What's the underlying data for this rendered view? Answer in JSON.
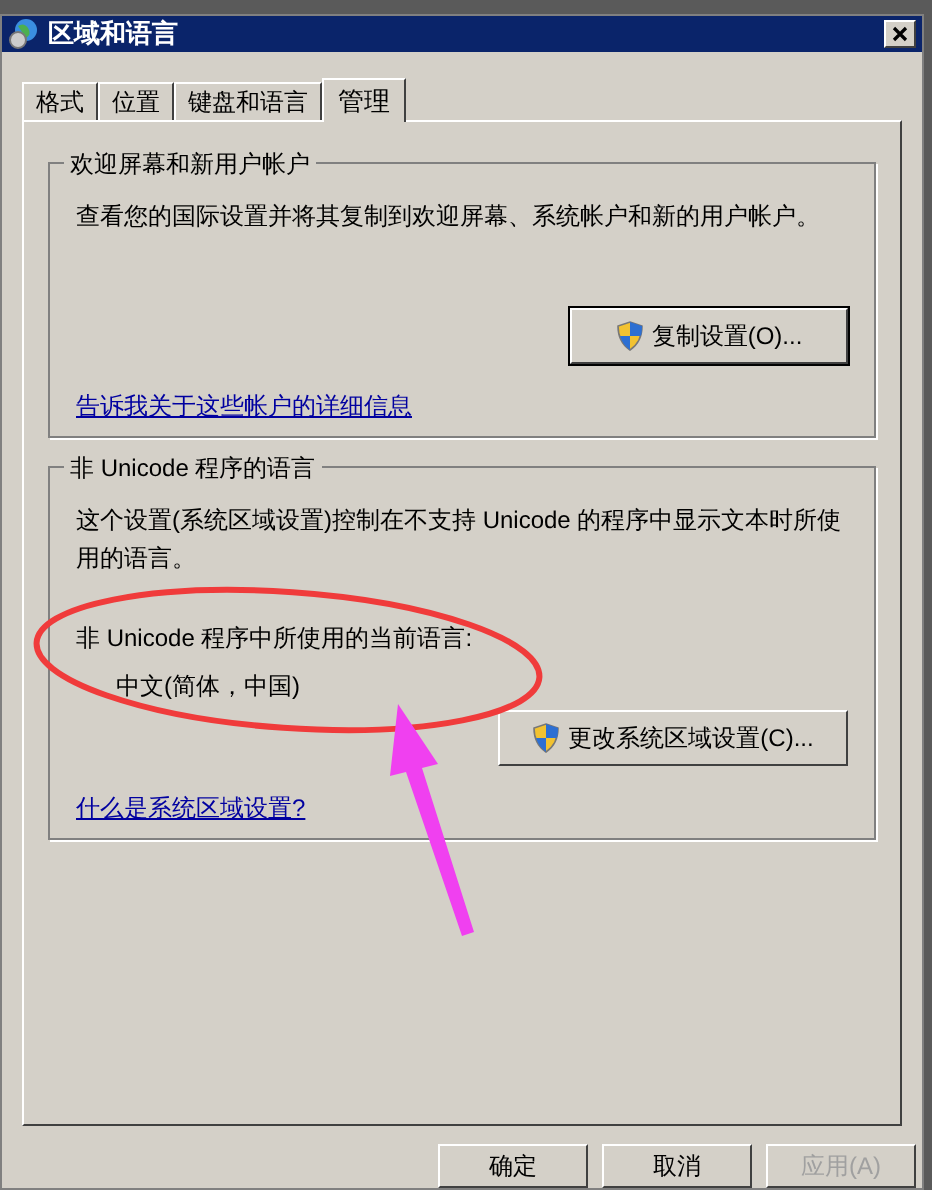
{
  "window": {
    "title": "区域和语言"
  },
  "tabs": [
    {
      "label": "格式",
      "selected": false
    },
    {
      "label": "位置",
      "selected": false
    },
    {
      "label": "键盘和语言",
      "selected": false
    },
    {
      "label": "管理",
      "selected": true
    }
  ],
  "groups": [
    {
      "title": "欢迎屏幕和新用户帐户",
      "description": "查看您的国际设置并将其复制到欢迎屏幕、系统帐户和新的用户帐户。",
      "button": "复制设置(O)...",
      "link": "告诉我关于这些帐户的详细信息"
    },
    {
      "title": "非 Unicode 程序的语言",
      "description": "这个设置(系统区域设置)控制在不支持 Unicode 的程序中显示文本时所使用的语言。",
      "current_label": "非 Unicode 程序中所使用的当前语言:",
      "current_value": "中文(简体，中国)",
      "button": "更改系统区域设置(C)...",
      "link": "什么是系统区域设置?"
    }
  ],
  "buttons": [
    {
      "label": "确定",
      "disabled": false
    },
    {
      "label": "取消",
      "disabled": false
    },
    {
      "label": "应用(A)",
      "disabled": true
    }
  ]
}
